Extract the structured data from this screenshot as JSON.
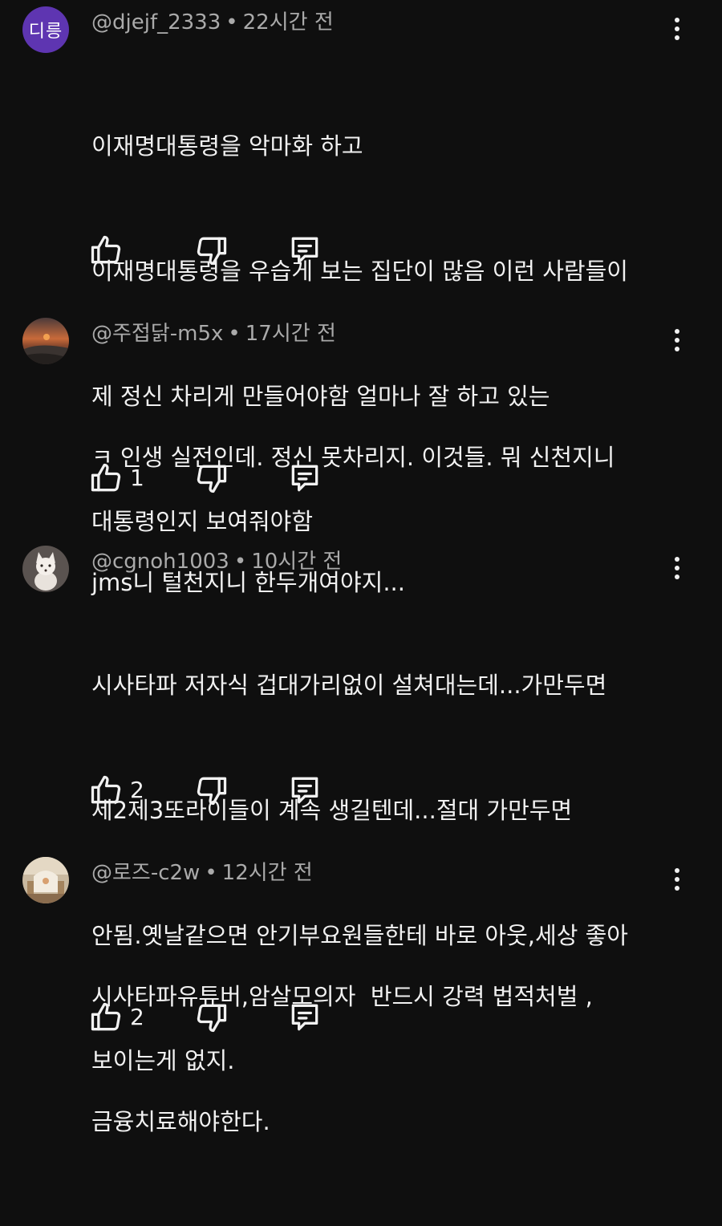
{
  "comments": [
    {
      "avatar_text": "디릉",
      "handle": "@djejf_2333",
      "separator": "•",
      "time": "22시간 전",
      "lines": [
        "이재명대통령을 악마화 하고",
        "이재명대통령을 우습게 보는 집단이 많음 이런 사람들이",
        "제 정신 차리게 만들어야함 얼마나 잘 하고 있는",
        "대통령인지 보여줘야함"
      ],
      "likes": ""
    },
    {
      "avatar_text": "",
      "handle": "@주접닭-m5x",
      "separator": "•",
      "time": "17시간 전",
      "lines": [
        "ㅋ 인생 실전인데. 정신 못차리지. 이것들. 뭐 신천지니",
        "jms니 털천지니 한두개여야지..."
      ],
      "likes": "1"
    },
    {
      "avatar_text": "",
      "handle": "@cgnoh1003",
      "separator": "•",
      "time": "10시간 전",
      "lines": [
        "시사타파 저자식 겁대가리없이 설쳐대는데...가만두면",
        "제2제3또라이들이 계속 생길텐데...절대 가만두면",
        "안됨.옛날같으면 안기부요원들한테 바로 아웃,세상 좋아",
        "보이는게 없지."
      ],
      "likes": "2"
    },
    {
      "avatar_text": "",
      "handle": "@로즈-c2w",
      "separator": "•",
      "time": "12시간 전",
      "lines": [
        "시사타파유튜버,암살모의자  반드시 강력 법적처벌 ,",
        "금융치료해야한다."
      ],
      "likes": "2"
    }
  ],
  "icons": {
    "like": "thumb-up-icon",
    "dislike": "thumb-down-icon",
    "reply": "reply-comment-icon",
    "more": "more-vertical-icon"
  },
  "colors": {
    "background": "#0f0f0f",
    "text": "#f1f1f1",
    "meta": "#aaaaaa",
    "avatar_letter_bg": "#5e35b1"
  }
}
